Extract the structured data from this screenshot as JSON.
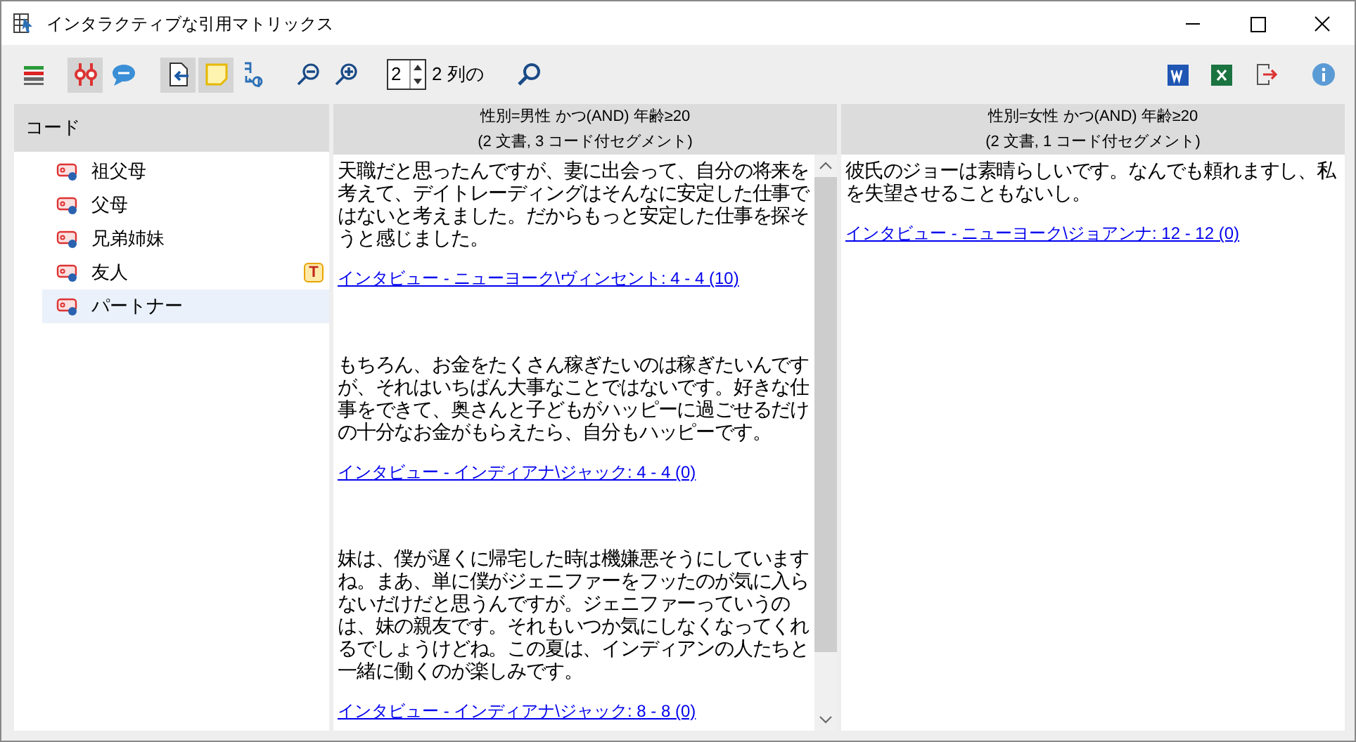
{
  "window": {
    "title": "インタラクティブな引用マトリックス"
  },
  "toolbar": {
    "items": [
      {
        "kind": "levels",
        "pressed": false
      },
      {
        "kind": "filter",
        "pressed": true
      },
      {
        "kind": "comment",
        "pressed": false
      },
      {
        "kind": "import",
        "pressed": true
      },
      {
        "kind": "note",
        "pressed": true
      },
      {
        "kind": "translate",
        "pressed": false
      },
      {
        "kind": "zoom-out",
        "pressed": false
      },
      {
        "kind": "zoom-in",
        "pressed": false
      },
      {
        "kind": "spinner",
        "value": "2"
      },
      {
        "kind": "label",
        "text": "2 列の"
      },
      {
        "kind": "search",
        "pressed": false
      }
    ],
    "right_items": [
      {
        "kind": "word"
      },
      {
        "kind": "excel"
      },
      {
        "kind": "export"
      },
      {
        "kind": "info"
      }
    ]
  },
  "codes": {
    "header": "コード",
    "items": [
      {
        "label": "祖父母",
        "selected": false
      },
      {
        "label": "父母",
        "selected": false
      },
      {
        "label": "兄弟姉妹",
        "selected": false
      },
      {
        "label": "友人",
        "selected": false,
        "badge": "T"
      },
      {
        "label": "パートナー",
        "selected": true
      }
    ]
  },
  "columns": [
    {
      "title": "性別=男性 かつ(AND) 年齢≥20",
      "subtitle": "(2 文書, 3 コード付セグメント)",
      "segments": [
        {
          "text": "天職だと思ったんですが、妻に出会って、自分の将来を考えて、デイトレーディングはそんなに安定した仕事ではないと考えました。だからもっと安定した仕事を探そうと感じました。",
          "source": "インタビュー - ニューヨーク\\ヴィンセント: 4 - 4  (10)"
        },
        {
          "text": "もちろん、お金をたくさん稼ぎたいのは稼ぎたいんですが、それはいちばん大事なことではないです。好きな仕事をできて、奥さんと子どもがハッピーに過ごせるだけの十分なお金がもらえたら、自分もハッピーです。",
          "source": "インタビュー - インディアナ\\ジャック: 4 - 4  (0)"
        },
        {
          "text": "妹は、僕が遅くに帰宅した時は機嫌悪そうにしていますね。まあ、単に僕がジェニファーをフッたのが気に入らないだけだと思うんですが。ジェニファーっていうのは、妹の親友です。それもいつか気にしなくなってくれるでしょうけどね。この夏は、インディアンの人たちと一緒に働くのが楽しみです。",
          "source": "インタビュー - インディアナ\\ジャック: 8 - 8  (0)"
        }
      ]
    },
    {
      "title": "性別=女性 かつ(AND) 年齢≥20",
      "subtitle": "(2 文書, 1 コード付セグメント)",
      "segments": [
        {
          "text": "彼氏のジョーは素晴らしいです。なんでも頼れますし、私を失望させることもないし。",
          "source": "インタビュー - ニューヨーク\\ジョアンナ: 12 - 12  (0)"
        }
      ]
    }
  ]
}
